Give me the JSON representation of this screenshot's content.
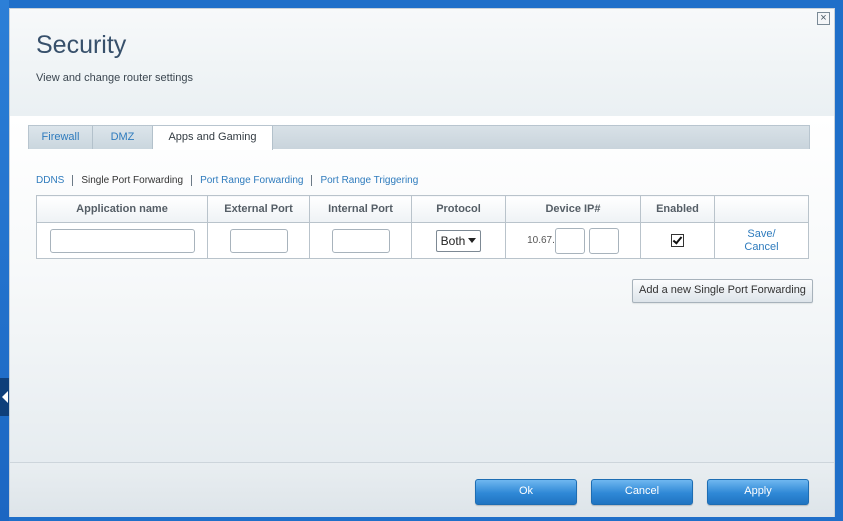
{
  "dialog": {
    "title": "Security",
    "subtitle": "View and change router settings",
    "close_glyph": "×"
  },
  "tabs": [
    {
      "label": "Firewall",
      "active": false
    },
    {
      "label": "DMZ",
      "active": false
    },
    {
      "label": "Apps and Gaming",
      "active": true
    }
  ],
  "subnav": [
    {
      "label": "DDNS",
      "current": false
    },
    {
      "label": "Single Port Forwarding",
      "current": true
    },
    {
      "label": "Port Range Forwarding",
      "current": false
    },
    {
      "label": "Port Range Triggering",
      "current": false
    }
  ],
  "table": {
    "headers": [
      "Application name",
      "External Port",
      "Internal Port",
      "Protocol",
      "Device IP#",
      "Enabled",
      ""
    ],
    "row": {
      "application_name": "",
      "external_port": "",
      "internal_port": "",
      "protocol": "Both",
      "ip_prefix": "10.67.",
      "ip_octet3": "",
      "ip_octet4": "",
      "enabled": true,
      "save_label": "Save/",
      "cancel_label": "Cancel"
    }
  },
  "add_button": "Add a new Single Port Forwarding",
  "footer": {
    "ok": "Ok",
    "cancel": "Cancel",
    "apply": "Apply"
  },
  "colors": {
    "accent_link": "#2e7bbd",
    "primary_button": "#2f88d6",
    "background": "#1f6fc9"
  }
}
